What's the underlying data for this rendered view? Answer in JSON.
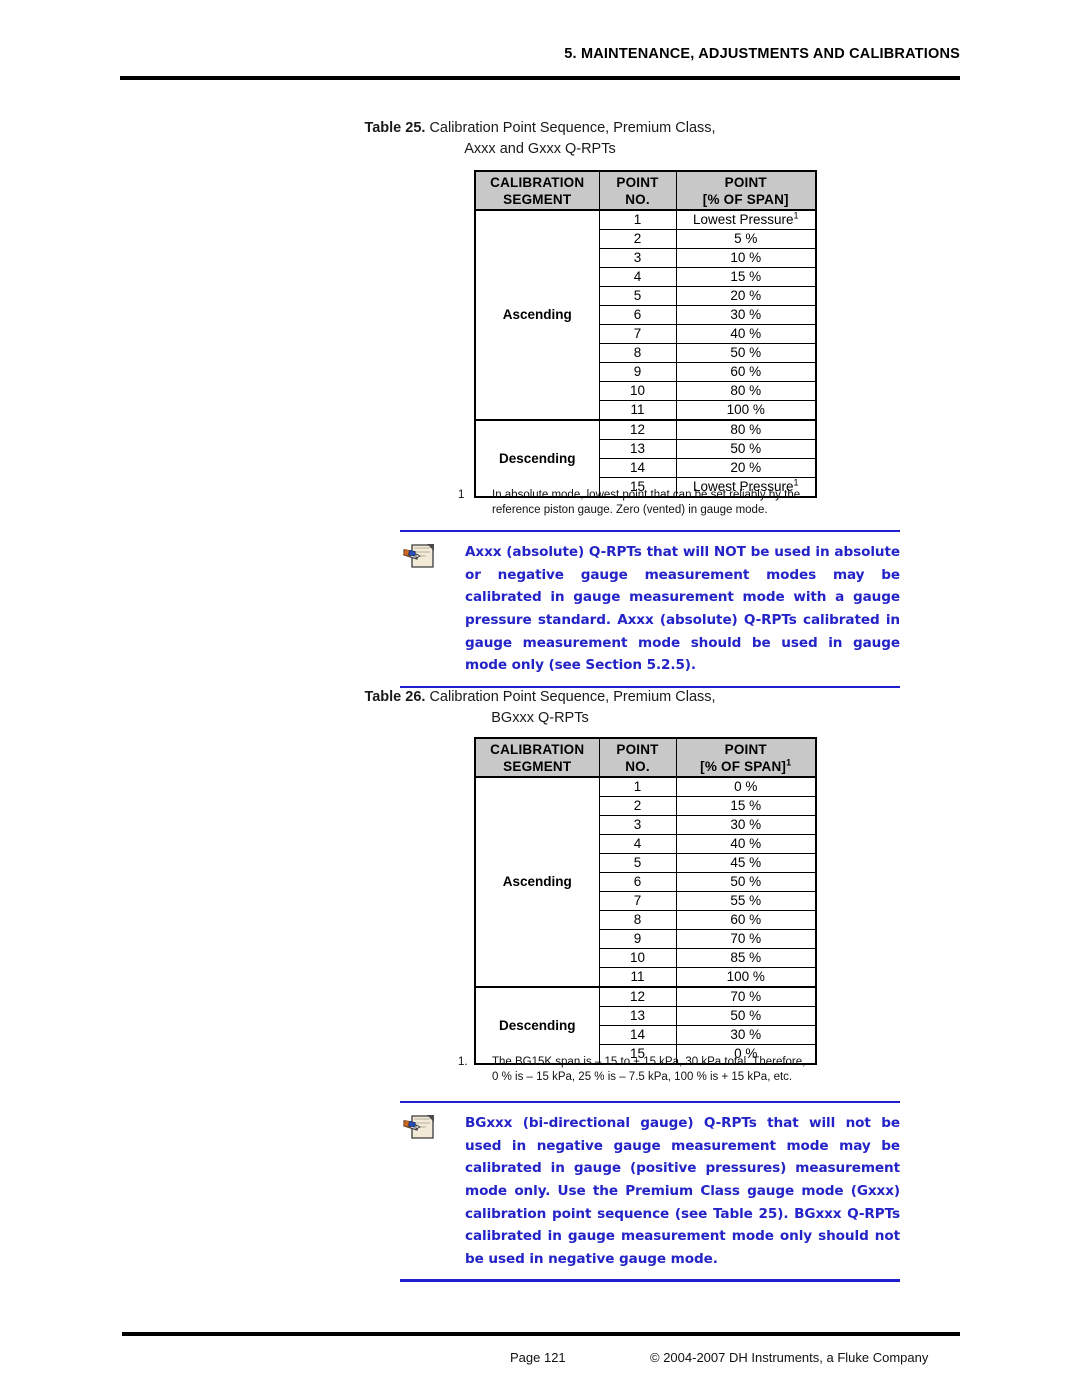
{
  "header": {
    "title": "5.  MAINTENANCE, ADJUSTMENTS AND CALIBRATIONS"
  },
  "table25": {
    "caption_label": "Table 25.",
    "caption_line1": "Calibration Point Sequence, Premium Class,",
    "caption_line2": "Axxx and Gxxx Q-RPTs",
    "columns": {
      "segment_line1": "CALIBRATION",
      "segment_line2": "SEGMENT",
      "point_no_line1": "POINT",
      "point_no_line2": "NO.",
      "span_line1": "POINT",
      "span_line2": "[% OF SPAN]",
      "span_sup": ""
    },
    "segments": [
      {
        "name": "Ascending",
        "rows": [
          {
            "no": "1",
            "span": "Lowest Pressure",
            "sup": "1"
          },
          {
            "no": "2",
            "span": "5 %",
            "sup": ""
          },
          {
            "no": "3",
            "span": "10 %",
            "sup": ""
          },
          {
            "no": "4",
            "span": "15 %",
            "sup": ""
          },
          {
            "no": "5",
            "span": "20 %",
            "sup": ""
          },
          {
            "no": "6",
            "span": "30 %",
            "sup": ""
          },
          {
            "no": "7",
            "span": "40 %",
            "sup": ""
          },
          {
            "no": "8",
            "span": "50 %",
            "sup": ""
          },
          {
            "no": "9",
            "span": "60 %",
            "sup": ""
          },
          {
            "no": "10",
            "span": "80 %",
            "sup": ""
          },
          {
            "no": "11",
            "span": "100 %",
            "sup": ""
          }
        ]
      },
      {
        "name": "Descending",
        "rows": [
          {
            "no": "12",
            "span": "80 %",
            "sup": ""
          },
          {
            "no": "13",
            "span": "50 %",
            "sup": ""
          },
          {
            "no": "14",
            "span": "20 %",
            "sup": ""
          },
          {
            "no": "15",
            "span": "Lowest Pressure",
            "sup": "1"
          }
        ]
      }
    ],
    "footnote": {
      "mark": "1",
      "line1": "In absolute mode, lowest point that can be set  reliably by the",
      "line2": "reference piston gauge.  Zero (vented) in gauge mode."
    }
  },
  "note1": {
    "icon": "note-pencil-icon",
    "line1": "Axxx (absolute) Q-RPTs that will NOT be used in absolute or",
    "line2": "negative gauge measurement modes may be calibrated in",
    "line3": "gauge measurement mode with a gauge pressure standard.",
    "line4": "Axxx (absolute) Q-RPTs calibrated in gauge measurement",
    "line5": "mode should be used in gauge mode only  (see Section 5.2.5)."
  },
  "table26": {
    "caption_label": "Table 26.",
    "caption_line1": "Calibration Point Sequence, Premium Class,",
    "caption_line2": "BGxxx Q-RPTs",
    "columns": {
      "segment_line1": "CALIBRATION",
      "segment_line2": "SEGMENT",
      "point_no_line1": "POINT",
      "point_no_line2": "NO.",
      "span_line1": "POINT",
      "span_line2": "[% OF SPAN]",
      "span_sup": "1"
    },
    "segments": [
      {
        "name": "Ascending",
        "rows": [
          {
            "no": "1",
            "span": "0 %",
            "sup": ""
          },
          {
            "no": "2",
            "span": "15 %",
            "sup": ""
          },
          {
            "no": "3",
            "span": "30 %",
            "sup": ""
          },
          {
            "no": "4",
            "span": "40 %",
            "sup": ""
          },
          {
            "no": "5",
            "span": "45 %",
            "sup": ""
          },
          {
            "no": "6",
            "span": "50 %",
            "sup": ""
          },
          {
            "no": "7",
            "span": "55 %",
            "sup": ""
          },
          {
            "no": "8",
            "span": "60 %",
            "sup": ""
          },
          {
            "no": "9",
            "span": "70 %",
            "sup": ""
          },
          {
            "no": "10",
            "span": "85 %",
            "sup": ""
          },
          {
            "no": "11",
            "span": "100 %",
            "sup": ""
          }
        ]
      },
      {
        "name": "Descending",
        "rows": [
          {
            "no": "12",
            "span": "70 %",
            "sup": ""
          },
          {
            "no": "13",
            "span": "50 %",
            "sup": ""
          },
          {
            "no": "14",
            "span": "30 %",
            "sup": ""
          },
          {
            "no": "15",
            "span": "0 %",
            "sup": ""
          }
        ]
      }
    ],
    "footnote": {
      "mark": "1.",
      "line1": "The BG15K span is – 15 to + 15 kPa, 30 kPa total.  Therefore,",
      "line2": "0 % is – 15 kPa, 25 % is – 7.5 kPa, 100 % is + 15 kPa, etc."
    }
  },
  "note2": {
    "icon": "note-pencil-icon",
    "line1": "BGxxx (bi-directional gauge)  Q-RPTs that will not be used in",
    "line2": "negative gauge measurement mode may be calibrated in",
    "line3": "gauge (positive pressures) measurement mode only.   Use the",
    "line4": "Premium Class gauge mode (Gxxx) calibration point sequence",
    "line5": "(see  Table  25).     BGxxx  Q-RPTs  calibrated  in  gauge",
    "line6": "measurement  mode  only  should  not  be  used  in  negative",
    "line7": "gauge mode."
  },
  "footer": {
    "page": "Page 121",
    "copyright": "© 2004-2007 DH Instruments, a Fluke Company"
  },
  "colors": {
    "note_blue": "#2323c8",
    "note_rule_blue": "#1f1fd0",
    "header_fill": "#c8c8c8"
  }
}
